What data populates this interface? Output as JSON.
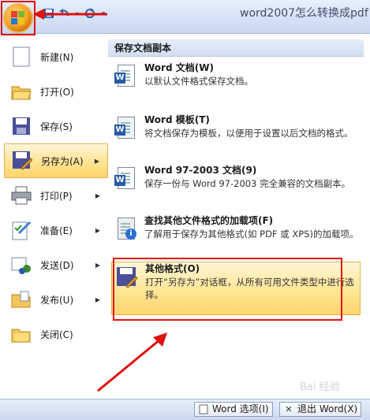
{
  "window": {
    "title": "word2007怎么转换成pdf -"
  },
  "quick_access": {
    "icons": [
      "save-icon",
      "undo-icon",
      "redo-icon",
      "customize-icon"
    ]
  },
  "left_menu": {
    "items": [
      {
        "label": "新建(N)",
        "icon": "new-document-icon",
        "has_submenu": false
      },
      {
        "label": "打开(O)",
        "icon": "open-folder-icon",
        "has_submenu": false
      },
      {
        "label": "保存(S)",
        "icon": "save-icon",
        "has_submenu": false
      },
      {
        "label": "另存为(A)",
        "icon": "save-as-icon",
        "has_submenu": true,
        "active": true
      },
      {
        "label": "打印(P)",
        "icon": "printer-icon",
        "has_submenu": true
      },
      {
        "label": "准备(E)",
        "icon": "prepare-icon",
        "has_submenu": true
      },
      {
        "label": "发送(D)",
        "icon": "send-icon",
        "has_submenu": true
      },
      {
        "label": "发布(U)",
        "icon": "publish-icon",
        "has_submenu": true
      },
      {
        "label": "关闭(C)",
        "icon": "close-folder-icon",
        "has_submenu": false
      }
    ]
  },
  "right_panel": {
    "heading": "保存文档副本",
    "items": [
      {
        "title": "Word 文档(W)",
        "desc": "以默认文件格式保存文档。",
        "icon": "word-document-icon"
      },
      {
        "title": "Word 模板(T)",
        "desc": "将文档保存为模板，以便用于设置以后文档的格式。",
        "icon": "word-template-icon"
      },
      {
        "title": "Word 97-2003 文档(9)",
        "desc": "保存一份与 Word 97-2003 完全兼容的文档副本。",
        "icon": "word-97-icon"
      },
      {
        "title": "查找其他文件格式的加载项(F)",
        "desc": "了解用于保存为其他格式(如 PDF 或 XPS)的加载项。",
        "icon": "addin-info-icon"
      },
      {
        "title": "其他格式(O)",
        "desc": "打开“另存为”对话框，从所有可用文件类型中进行选择。",
        "icon": "other-formats-icon",
        "active": true
      }
    ]
  },
  "footer": {
    "options_label": "Word 选项(I)",
    "exit_label": "退出 Word(X)"
  },
  "watermark": "Bai 经验",
  "colors": {
    "annotation_red": "#e01010",
    "highlight": "#ffe59a",
    "ribbon_blue": "#d4e1f4"
  }
}
